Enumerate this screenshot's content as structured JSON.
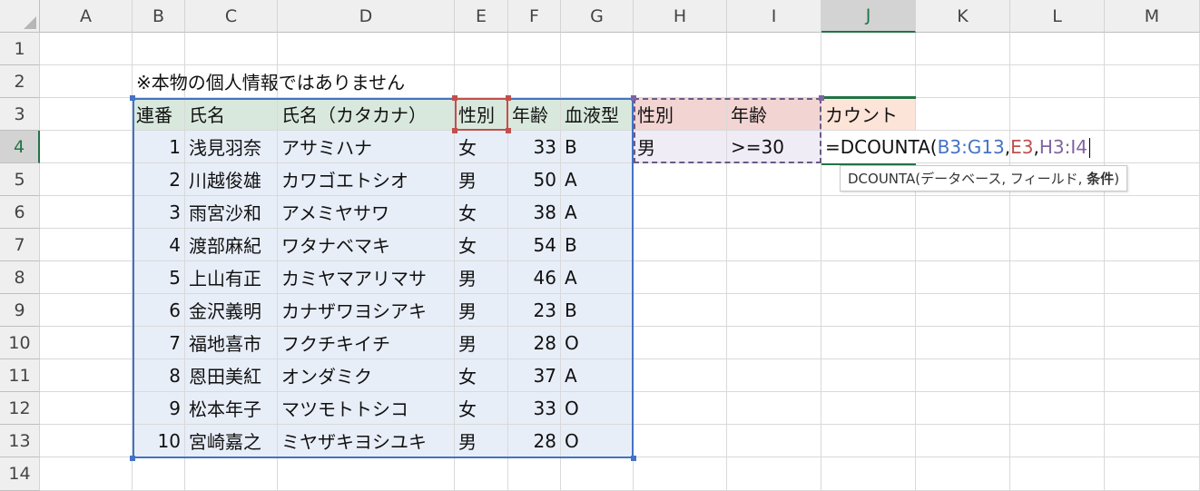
{
  "columns": [
    "A",
    "B",
    "C",
    "D",
    "E",
    "F",
    "G",
    "H",
    "I",
    "J",
    "K",
    "L",
    "M"
  ],
  "rows": [
    "1",
    "2",
    "3",
    "4",
    "5",
    "6",
    "7",
    "8",
    "9",
    "10",
    "11",
    "12",
    "13",
    "14"
  ],
  "note": "※本物の個人情報ではありません",
  "table": {
    "headers": [
      "連番",
      "氏名",
      "氏名（カタカナ）",
      "性別",
      "年齢",
      "血液型"
    ],
    "records": [
      [
        "1",
        "浅見羽奈",
        "アサミハナ",
        "女",
        "33",
        "B"
      ],
      [
        "2",
        "川越俊雄",
        "カワゴエトシオ",
        "男",
        "50",
        "A"
      ],
      [
        "3",
        "雨宮沙和",
        "アメミヤサワ",
        "女",
        "38",
        "A"
      ],
      [
        "4",
        "渡部麻紀",
        "ワタナベマキ",
        "女",
        "54",
        "B"
      ],
      [
        "5",
        "上山有正",
        "カミヤマアリマサ",
        "男",
        "46",
        "A"
      ],
      [
        "6",
        "金沢義明",
        "カナザワヨシアキ",
        "男",
        "23",
        "B"
      ],
      [
        "7",
        "福地喜市",
        "フクチキイチ",
        "男",
        "28",
        "O"
      ],
      [
        "8",
        "恩田美紅",
        "オンダミク",
        "女",
        "37",
        "A"
      ],
      [
        "9",
        "松本年子",
        "マツモトトシコ",
        "女",
        "33",
        "O"
      ],
      [
        "10",
        "宮崎嘉之",
        "ミヤザキヨシユキ",
        "男",
        "28",
        "O"
      ]
    ]
  },
  "criteria": {
    "headers": [
      "性別",
      "年齢"
    ],
    "values": [
      "男",
      ">=30"
    ]
  },
  "count_header": "カウント",
  "formula": {
    "prefix": "=DCOUNTA(",
    "arg1": "B3:G13",
    "sep1": ",",
    "arg2": "E3",
    "sep2": ",",
    "arg3": "H3:I4"
  },
  "tooltip": {
    "text": "DCOUNTA(データベース, フィールド, ",
    "bold": "条件",
    "close": ")"
  },
  "colors": {
    "accent_green": "#217346",
    "range_blue": "#4472c4",
    "range_red": "#c0504d",
    "range_purple": "#8064a2"
  }
}
